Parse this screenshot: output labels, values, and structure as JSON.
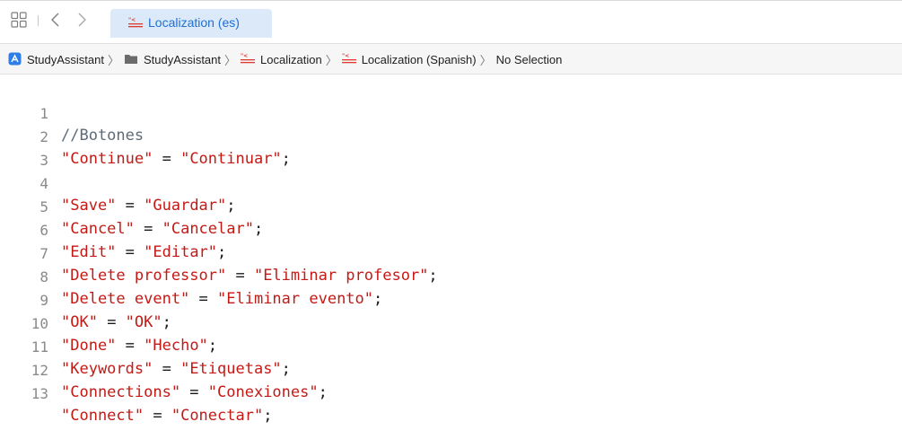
{
  "tab": {
    "label": "Localization (es)"
  },
  "breadcrumbs": [
    {
      "label": "StudyAssistant",
      "icon": "app-icon"
    },
    {
      "label": "StudyAssistant",
      "icon": "folder-icon"
    },
    {
      "label": "Localization",
      "icon": "strings-file-icon"
    },
    {
      "label": "Localization (Spanish)",
      "icon": "strings-file-icon"
    },
    {
      "label": "No Selection",
      "icon": ""
    }
  ],
  "editor": {
    "lines": [
      {
        "num": "1",
        "comment": "//Botones",
        "key": "",
        "eq": "",
        "value": "",
        "semi": ""
      },
      {
        "num": "2",
        "comment": "",
        "key": "\"Continue\"",
        "eq": " = ",
        "value": "\"Continuar\"",
        "semi": ";"
      },
      {
        "num": "3",
        "comment": "",
        "key": "",
        "eq": "",
        "value": "",
        "semi": ""
      },
      {
        "num": "4",
        "comment": "",
        "key": "\"Save\"",
        "eq": " = ",
        "value": "\"Guardar\"",
        "semi": ";"
      },
      {
        "num": "5",
        "comment": "",
        "key": "\"Cancel\"",
        "eq": " = ",
        "value": "\"Cancelar\"",
        "semi": ";"
      },
      {
        "num": "6",
        "comment": "",
        "key": "\"Edit\"",
        "eq": " = ",
        "value": "\"Editar\"",
        "semi": ";"
      },
      {
        "num": "7",
        "comment": "",
        "key": "\"Delete professor\"",
        "eq": " = ",
        "value": "\"Eliminar profesor\"",
        "semi": ";"
      },
      {
        "num": "8",
        "comment": "",
        "key": "\"Delete event\"",
        "eq": " = ",
        "value": "\"Eliminar evento\"",
        "semi": ";"
      },
      {
        "num": "9",
        "comment": "",
        "key": "\"OK\"",
        "eq": " = ",
        "value": "\"OK\"",
        "semi": ";"
      },
      {
        "num": "10",
        "comment": "",
        "key": "\"Done\"",
        "eq": " = ",
        "value": "\"Hecho\"",
        "semi": ";"
      },
      {
        "num": "11",
        "comment": "",
        "key": "\"Keywords\"",
        "eq": " = ",
        "value": "\"Etiquetas\"",
        "semi": ";"
      },
      {
        "num": "12",
        "comment": "",
        "key": "\"Connections\"",
        "eq": " = ",
        "value": "\"Conexiones\"",
        "semi": ";"
      },
      {
        "num": "13",
        "comment": "",
        "key": "\"Connect\"",
        "eq": " = ",
        "value": "\"Conectar\"",
        "semi": ";"
      }
    ]
  },
  "colors": {
    "string": "#c41a16",
    "comment": "#5d6c79",
    "line_number": "#8a8a8a",
    "tab_accent": "#1f6fd1",
    "tab_background": "#dce9f9"
  }
}
